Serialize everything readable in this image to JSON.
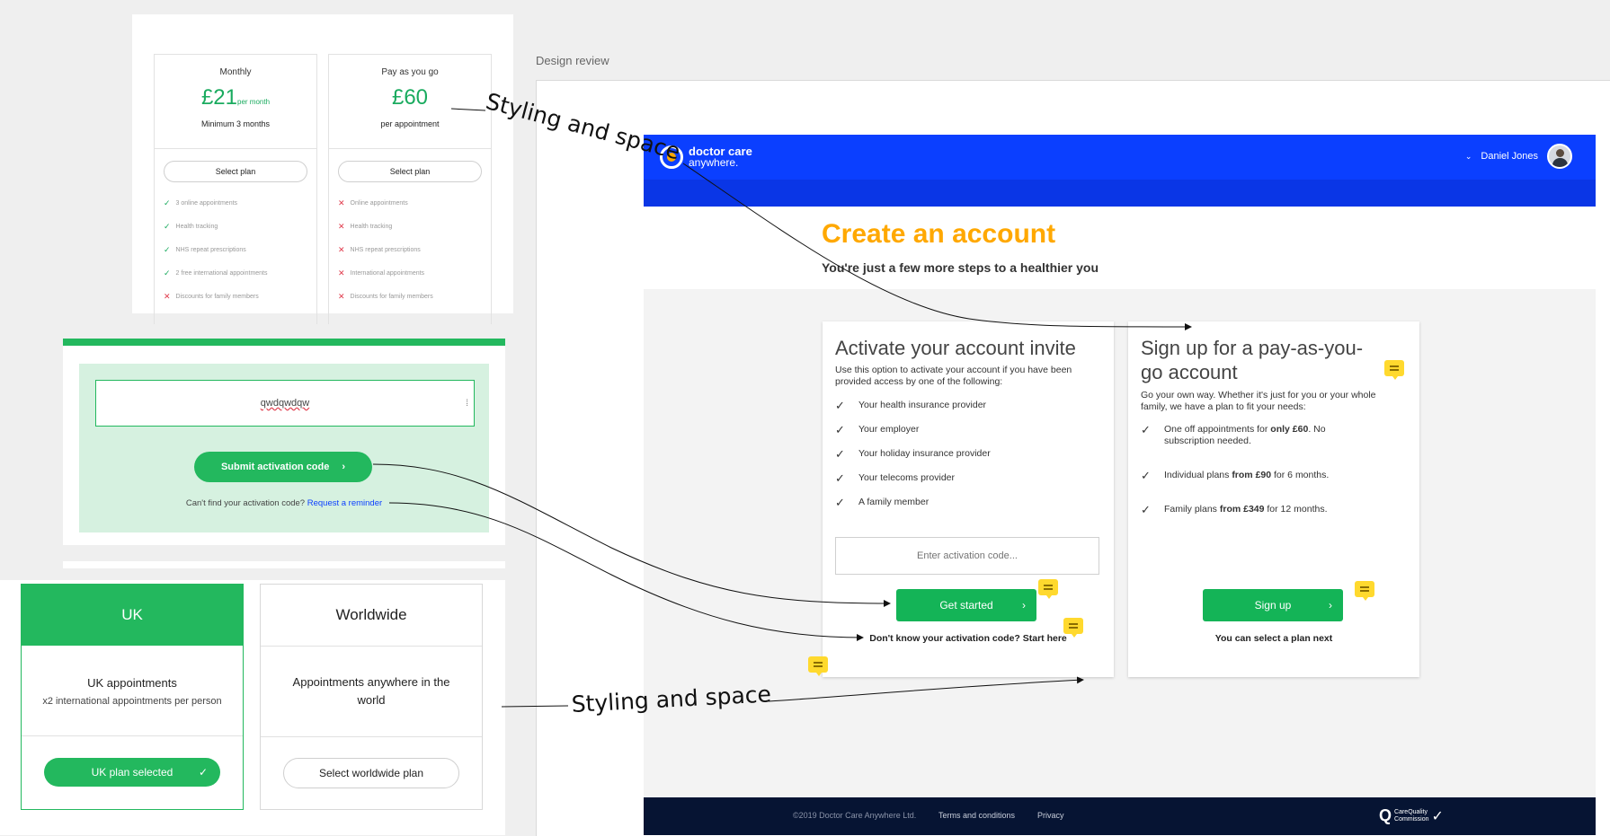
{
  "pricing": {
    "plans": [
      {
        "name": "Monthly",
        "price": "£21",
        "price_unit": "per month",
        "subtitle": "Minimum 3 months",
        "select_label": "Select plan",
        "features": [
          {
            "text": "3 online appointments",
            "included": true
          },
          {
            "text": "Health tracking",
            "included": true
          },
          {
            "text": "NHS repeat prescriptions",
            "included": true
          },
          {
            "text": "2 free international appointments",
            "included": true
          },
          {
            "text": "Discounts for family members",
            "included": false
          }
        ]
      },
      {
        "name": "Pay as you go",
        "price": "£60",
        "price_unit": "",
        "subtitle": "per appointment",
        "select_label": "Select plan",
        "features": [
          {
            "text": "Online appointments",
            "included": false
          },
          {
            "text": "Health tracking",
            "included": false
          },
          {
            "text": "NHS repeat prescriptions",
            "included": false
          },
          {
            "text": "International appointments",
            "included": false
          },
          {
            "text": "Discounts for family members",
            "included": false
          }
        ]
      }
    ]
  },
  "activation": {
    "input_value": "qwdqwdqw",
    "submit_label": "Submit activation code",
    "help_text": "Can't find your activation code?",
    "help_link": "Request a reminder"
  },
  "regions": {
    "uk": {
      "title": "UK",
      "body_title": "UK appointments",
      "body_sub": "x2 international appointments per person",
      "button": "UK plan selected"
    },
    "worldwide": {
      "title": "Worldwide",
      "body_title": "Appointments anywhere in the world",
      "button": "Select worldwide plan"
    }
  },
  "review": {
    "frame_title": "Design review",
    "notes": [
      "Styling and space",
      "Styling and space"
    ]
  },
  "site": {
    "logo_top": "doctor care",
    "logo_bottom": "anywhere.",
    "user_name": "Daniel Jones",
    "page_title": "Create an account",
    "page_subtitle": "You're just a few more steps to a healthier you",
    "activate": {
      "title": "Activate your account invite",
      "desc": "Use this option to activate your account if you have been provided access by one of the following:",
      "items": [
        "Your health insurance provider",
        "Your employer",
        "Your holiday insurance provider",
        "Your telecoms provider",
        "A family member"
      ],
      "placeholder": "Enter activation code...",
      "button": "Get started",
      "footnote": "Don't know your activation code? Start here"
    },
    "payg": {
      "title": "Sign up for a pay-as-you-go account",
      "desc": "Go your own way. Whether it's just for you or your whole family, we have a plan to fit your needs:",
      "items": [
        [
          "One off appointments for ",
          "only £60",
          ". No subscription needed."
        ],
        [
          "Individual plans ",
          "from £90",
          " for 6 months."
        ],
        [
          "Family plans ",
          "from £349",
          " for 12 months."
        ]
      ],
      "button": "Sign up",
      "footnote": "You can select a plan next"
    },
    "footer": {
      "copyright": "©2019 Doctor Care Anywhere Ltd.",
      "links": [
        "Terms and conditions",
        "Privacy"
      ],
      "cqc_top": "CareQuality",
      "cqc_bottom": "Commission"
    }
  },
  "colors": {
    "brand_blue": "#0b3fff",
    "green": "#14b457",
    "orange": "#ffa800",
    "navy": "#061433",
    "comment": "#ffd92e"
  }
}
